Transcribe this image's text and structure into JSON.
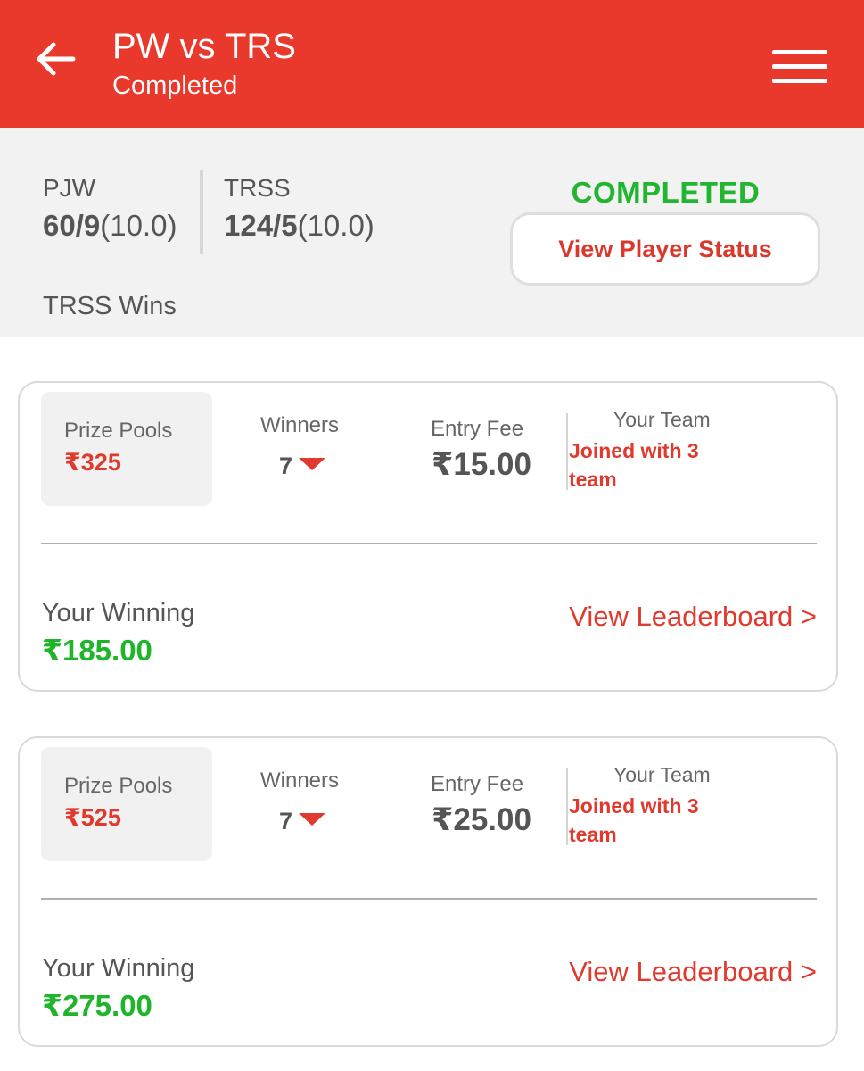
{
  "header": {
    "title": "PW vs TRS",
    "subtitle": "Completed"
  },
  "match": {
    "team1": {
      "name": "PJW",
      "score": "60/9",
      "overs": "(10.0)"
    },
    "team2": {
      "name": "TRSS",
      "score": "124/5",
      "overs": "(10.0)"
    },
    "result": "TRSS Wins",
    "status": "COMPLETED",
    "player_status_button": "View Player Status"
  },
  "contests": [
    {
      "prize_pool_label": "Prize Pools",
      "prize_pool": "₹325",
      "winners_label": "Winners",
      "winners": "7",
      "entry_fee_label": "Entry Fee",
      "entry_fee": "₹15.00",
      "your_team_label": "Your Team",
      "joined_text": "Joined with 3 team",
      "your_winning_label": "Your Winning",
      "your_winning": "₹185.00",
      "leaderboard_link": "View Leaderboard >"
    },
    {
      "prize_pool_label": "Prize Pools",
      "prize_pool": "₹525",
      "winners_label": "Winners",
      "winners": "7",
      "entry_fee_label": "Entry Fee",
      "entry_fee": "₹25.00",
      "your_team_label": "Your Team",
      "joined_text": "Joined with 3 team",
      "your_winning_label": "Your Winning",
      "your_winning": "₹275.00",
      "leaderboard_link": "View Leaderboard >"
    }
  ],
  "colors": {
    "header_bg": "#e8392c",
    "accent_red": "#e0392d",
    "success_green": "#22b52f",
    "panel_bg": "#f2f2f2"
  },
  "icons": {
    "back": "arrow-left-icon",
    "menu": "hamburger-menu-icon",
    "winners_dropdown": "caret-down-icon"
  }
}
